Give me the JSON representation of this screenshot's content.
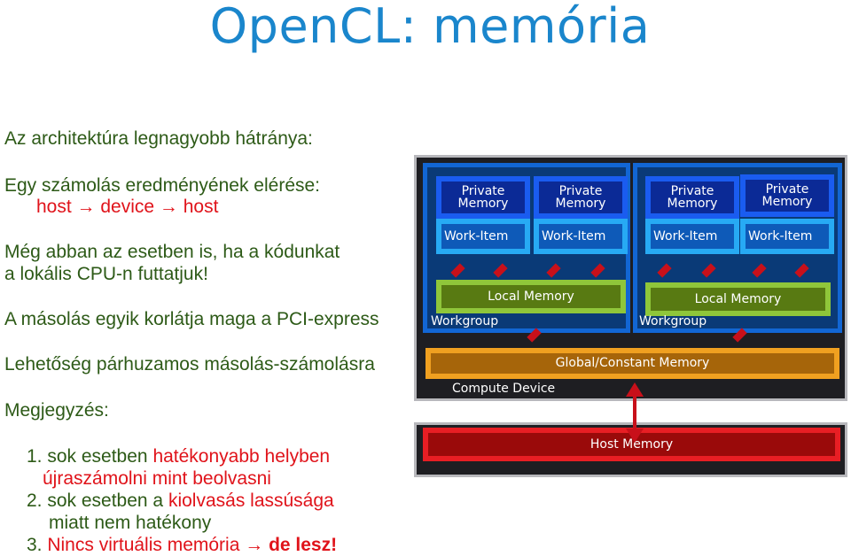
{
  "slide": {
    "title": "OpenCL: memória",
    "body": {
      "line1": "Az architektúra legnagyobb hátránya:",
      "line2": "Egy számolás eredményének elérése:",
      "line3": "host → device → host",
      "line4": "Még abban az esetben is, ha a kódunkat",
      "line5": "a lokális CPU-n futtatjuk!",
      "line6": "A másolás egyik korlátja maga a PCI-express",
      "line7": "Lehetőség párhuzamos másolás-számolásra",
      "line8": "Megjegyzés:"
    },
    "notes": [
      {
        "num": "1.",
        "plain": " sok esetben ",
        "highlight": "hatékonyabb helyben",
        "cont_highlight": "újraszámolni mint beolvasni"
      },
      {
        "num": "2.",
        "plain": " sok esetben a ",
        "highlight": "kiolvasás lassúsága",
        "cont_plain": "miatt nem hatékony"
      },
      {
        "num": "3.",
        "highlight": " Nincs virtuális memória → ",
        "bold_highlight": "de lesz!"
      }
    ]
  },
  "diagram": {
    "workgroups": [
      {
        "label": "Workgroup",
        "private_memories": [
          {
            "line1": "Private",
            "line2": "Memory"
          },
          {
            "line1": "Private",
            "line2": "Memory"
          }
        ],
        "work_items": [
          "Work-Item",
          "Work-Item"
        ],
        "local_memory": "Local Memory"
      },
      {
        "label": "Workgroup",
        "private_memories": [
          {
            "line1": "Private",
            "line2": "Memory"
          },
          {
            "line1": "Private",
            "line2": "Memory"
          }
        ],
        "work_items": [
          "Work-Item",
          "Work-Item"
        ],
        "local_memory": "Local Memory"
      }
    ],
    "global_memory": "Global/Constant Memory",
    "compute_device": "Compute  Device",
    "host_memory": "Host Memory",
    "host": "Host"
  },
  "colors": {
    "title": "#1a86cc",
    "body_text": "#2d5a17",
    "highlight": "#e0131a"
  }
}
